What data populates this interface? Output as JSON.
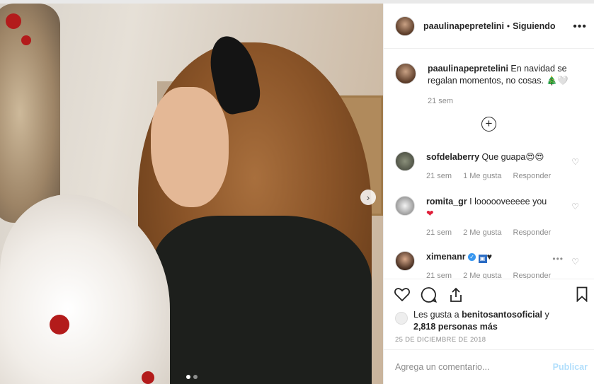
{
  "post": {
    "carousel": {
      "slide_index": 1,
      "slide_count": 2
    }
  },
  "header": {
    "username": "paaulinapepretelini",
    "separator": "•",
    "follow_status": "Siguiendo",
    "more": "•••"
  },
  "caption": {
    "username": "paaulinapepretelini",
    "text": "En navidad se regalan momentos, no cosas. 🎄🤍",
    "time": "21 sem"
  },
  "load_more": "+",
  "comments": [
    {
      "username": "sofdelaberry",
      "text": "Que guapa😍😍",
      "time": "21 sem",
      "likes": "1 Me gusta",
      "reply": "Responder"
    },
    {
      "username": "romita_gr",
      "text": "I loooooveeeee you",
      "heart": "❤",
      "time": "21 sem",
      "likes": "2 Me gusta",
      "reply": "Responder"
    },
    {
      "username": "ximenanr",
      "verified": "✓",
      "flag": "🇺",
      "heart": "♥",
      "time": "21 sem",
      "likes": "2 Me gusta",
      "reply": "Responder",
      "more": "•••"
    }
  ],
  "actions": {
    "like": "♡",
    "comment": "◯",
    "share": "⇧"
  },
  "likes": {
    "prefix": "Les gusta a",
    "user": "benitosantosoficial",
    "conj": "y",
    "others": "2,818 personas más"
  },
  "date": "25 DE DICIEMBRE DE 2018",
  "composer": {
    "placeholder": "Agrega un comentario...",
    "publish": "Publicar"
  },
  "icons": [
    "heart-icon",
    "comment-icon",
    "share-icon",
    "bookmark-icon",
    "plus-circle-icon",
    "chevron-right-icon"
  ],
  "colors": {
    "link_blue_disabled": "#b2dffc",
    "secondary_text": "#8e8e8e",
    "verified": "#3897f0"
  }
}
